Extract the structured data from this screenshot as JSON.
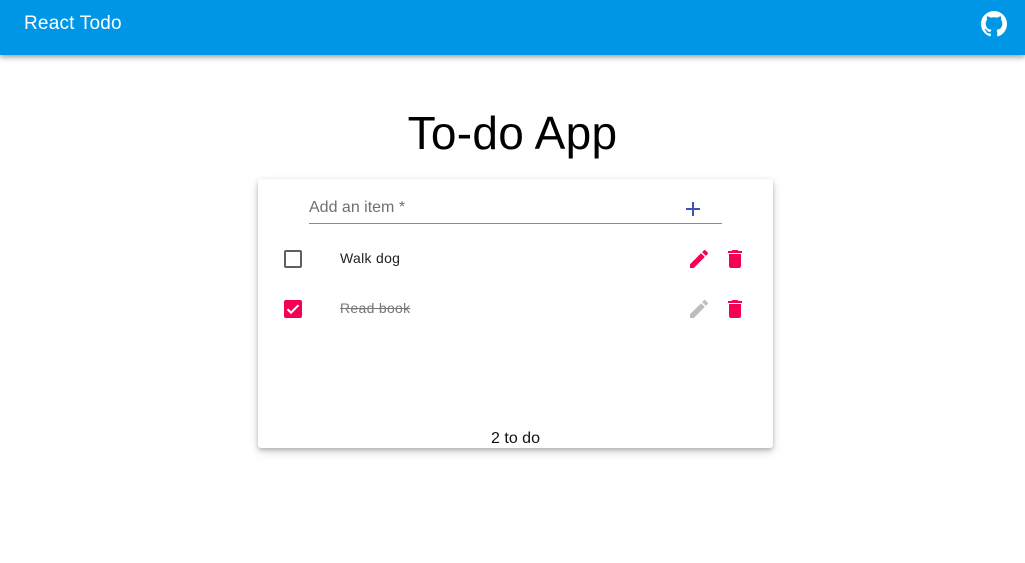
{
  "appbar": {
    "title": "React Todo",
    "icon": "github-icon",
    "background": "#0096e6"
  },
  "page": {
    "title": "To-do App"
  },
  "add_item": {
    "placeholder": "Add an item *",
    "value": "",
    "add_icon": "plus-icon",
    "accent": "#3f51b5"
  },
  "todos": [
    {
      "text": "Walk dog",
      "completed": false,
      "edit_icon": "pencil-icon",
      "delete_icon": "trash-icon"
    },
    {
      "text": "Read book",
      "completed": true,
      "edit_icon": "pencil-icon",
      "delete_icon": "trash-icon"
    }
  ],
  "footer": {
    "count_text": "2 to do"
  },
  "colors": {
    "secondary": "#f50057",
    "disabled": "#bdbdbd"
  }
}
